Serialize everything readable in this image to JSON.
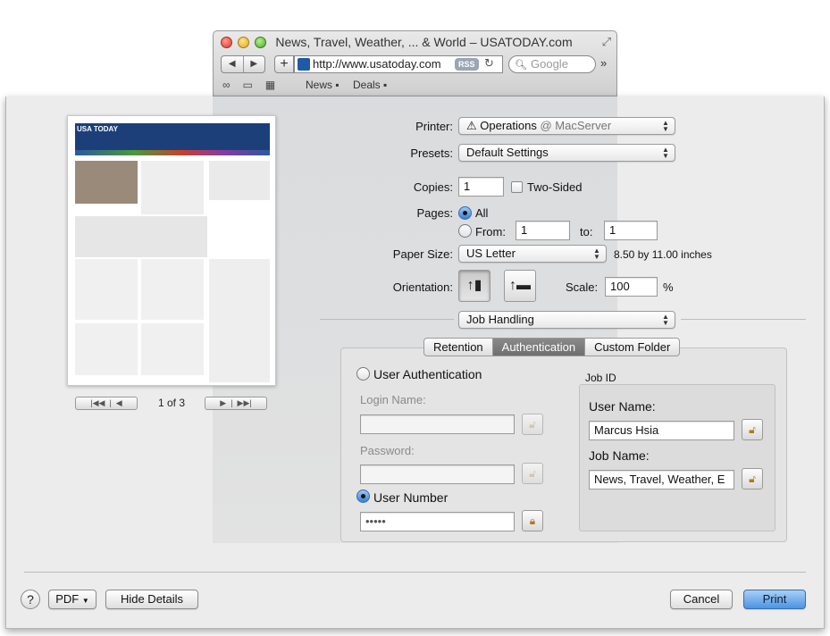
{
  "browser": {
    "title": "News, Travel, Weather, ... & World – USATODAY.com",
    "url": "http://www.usatoday.com",
    "rss": "RSS",
    "search_placeholder": "Google",
    "bookmarks": [
      "News",
      "Deals"
    ]
  },
  "preview": {
    "logo": "USA TODAY",
    "page_indicator": "1 of 3"
  },
  "printer": {
    "label": "Printer:",
    "value": "Operations",
    "location": "@ MacServer"
  },
  "presets": {
    "label": "Presets:",
    "value": "Default Settings"
  },
  "copies": {
    "label": "Copies:",
    "value": "1",
    "two_sided": "Two-Sided"
  },
  "pages": {
    "label": "Pages:",
    "all": "All",
    "from": "From:",
    "from_value": "1",
    "to": "to:",
    "to_value": "1"
  },
  "paper": {
    "label": "Paper Size:",
    "value": "US Letter",
    "dimensions": "8.50 by 11.00 inches"
  },
  "orientation": {
    "label": "Orientation:",
    "scale_label": "Scale:",
    "scale_value": "100",
    "percent": "%"
  },
  "section_popup": {
    "value": "Job Handling"
  },
  "tabs": [
    {
      "label": "Retention"
    },
    {
      "label": "Authentication"
    },
    {
      "label": "Custom Folder"
    }
  ],
  "auth": {
    "user_auth": "User Authentication",
    "login_name": "Login Name:",
    "password": "Password:",
    "user_number": "User Number",
    "user_number_value": "•••••"
  },
  "job_id": {
    "title": "Job ID",
    "user_name_label": "User Name:",
    "user_name_value": "Marcus Hsia",
    "job_name_label": "Job Name:",
    "job_name_value": "News, Travel, Weather, E"
  },
  "footer": {
    "help": "?",
    "pdf": "PDF",
    "hide_details": "Hide Details",
    "cancel": "Cancel",
    "print": "Print"
  }
}
